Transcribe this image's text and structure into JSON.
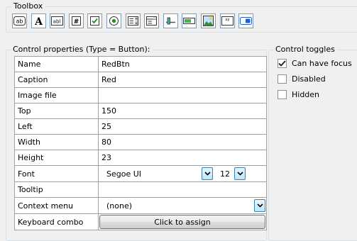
{
  "toolbox": {
    "title": "Toolbox",
    "tools": [
      {
        "icon": "button-tool-icon",
        "glyph": "ab"
      },
      {
        "icon": "label-tool-icon",
        "glyph": "A"
      },
      {
        "icon": "textbox-tool-icon",
        "glyph": "abl"
      },
      {
        "icon": "numeric-tool-icon",
        "glyph": "#"
      },
      {
        "icon": "checkbox-tool-icon",
        "glyph": ""
      },
      {
        "icon": "radio-tool-icon",
        "glyph": ""
      },
      {
        "icon": "listbox-tool-icon",
        "glyph": ""
      },
      {
        "icon": "combobox-tool-icon",
        "glyph": ""
      },
      {
        "icon": "slider-tool-icon",
        "glyph": ""
      },
      {
        "icon": "progressbar-tool-icon",
        "glyph": ""
      },
      {
        "icon": "image-tool-icon",
        "glyph": ""
      },
      {
        "icon": "chart-tool-icon",
        "glyph": "xy"
      },
      {
        "icon": "toggle-tool-icon",
        "glyph": ""
      }
    ]
  },
  "properties": {
    "title": "Control properties (Type = Button):",
    "rows": {
      "name": {
        "label": "Name",
        "value": "RedBtn"
      },
      "caption": {
        "label": "Caption",
        "value": "Red"
      },
      "image": {
        "label": "Image file",
        "value": ""
      },
      "top": {
        "label": "Top",
        "value": "150"
      },
      "left": {
        "label": "Left",
        "value": "25"
      },
      "width": {
        "label": "Width",
        "value": "80"
      },
      "height": {
        "label": "Height",
        "value": "23"
      },
      "font": {
        "label": "Font",
        "value": "Segoe UI",
        "size": "12"
      },
      "tooltip": {
        "label": "Tooltip",
        "value": ""
      },
      "context_menu": {
        "label": "Context menu",
        "value": "(none)"
      },
      "keyboard": {
        "label": "Keyboard combo",
        "button": "Click to assign"
      }
    }
  },
  "toggles": {
    "title": "Control toggles",
    "can_focus": {
      "label": "Can have focus",
      "checked": true
    },
    "disabled": {
      "label": "Disabled",
      "checked": false
    },
    "hidden": {
      "label": "Hidden",
      "checked": false
    }
  }
}
